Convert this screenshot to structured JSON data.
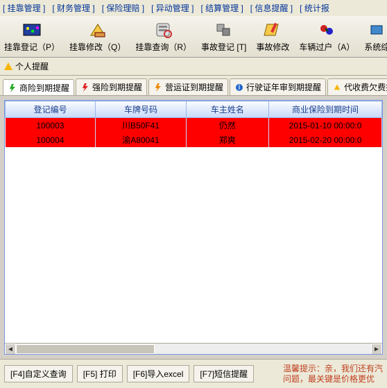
{
  "menu": {
    "items": [
      "[ 挂靠管理 ]",
      "[ 财务管理 ]",
      "[ 保险理赔 ]",
      "[ 异动管理 ]",
      "[ 结算管理 ]",
      "[ 信息提醒 ]",
      "[ 统计报"
    ]
  },
  "toolbar": {
    "items": [
      {
        "label": "挂靠登记（P）",
        "icon": "register-icon"
      },
      {
        "label": "挂靠修改（Q）",
        "icon": "edit-icon"
      },
      {
        "label": "挂靠查询（R）",
        "icon": "search-icon"
      },
      {
        "label": "事故登记 [T]",
        "icon": "accident-icon"
      },
      {
        "label": "事故修改",
        "icon": "accident-edit-icon"
      },
      {
        "label": "车辆过户（A）",
        "icon": "transfer-icon"
      },
      {
        "label": "系统综",
        "icon": "system-icon"
      }
    ]
  },
  "panel": {
    "title": "个人提醒",
    "icon": "warning-icon"
  },
  "tabs": {
    "items": [
      {
        "label": "商险到期提醒",
        "icon": "bolt-green",
        "active": true
      },
      {
        "label": "强险到期提醒",
        "icon": "bolt-red"
      },
      {
        "label": "营运证到期提醒",
        "icon": "bolt-orange"
      },
      {
        "label": "行驶证年审到期提醒",
        "icon": "info-blue"
      },
      {
        "label": "代收费欠费提醒",
        "icon": "warn-yellow"
      }
    ]
  },
  "grid": {
    "columns": [
      "登记编号",
      "车牌号码",
      "车主姓名",
      "商业保险到期时间"
    ],
    "rows": [
      {
        "reg": "100003",
        "plate": "川B50F41",
        "owner": "仍然",
        "expire": "2015-01-10 00:00:0"
      },
      {
        "reg": "100004",
        "plate": "渝A80041",
        "owner": "郑爽",
        "expire": "2015-02-20 00:00:0"
      }
    ]
  },
  "footer": {
    "buttons": [
      "[F4]自定义查询",
      "[F5] 打印",
      "[F6]导入excel",
      "[F7]短信提醒"
    ],
    "tip_line1": "温馨提示：亲，我们还有汽",
    "tip_line2": "问题，最关键是价格更优"
  }
}
